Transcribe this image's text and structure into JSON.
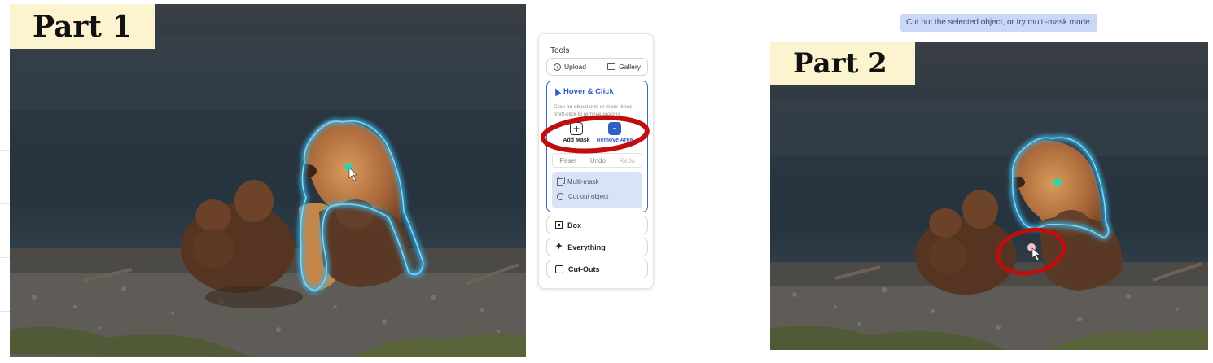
{
  "part1": {
    "label": "Part 1"
  },
  "part2": {
    "label": "Part 2"
  },
  "tooltip": "Cut out the selected object, or try multi-mask mode.",
  "tools_panel": {
    "title": "Tools",
    "upload_label": "Upload",
    "gallery_label": "Gallery",
    "hover_click": {
      "title": "Hover & Click",
      "description": "Click an object one or more times. Shift-click to remove regions.",
      "add_mask_label": "Add Mask",
      "remove_area_label": "Remove Area",
      "reset_label": "Reset",
      "undo_label": "Undo",
      "redo_label": "Redo",
      "multimask_label": "Multi-mask",
      "cutout_label": "Cut out object"
    },
    "box_label": "Box",
    "everything_label": "Everything",
    "cutouts_label": "Cut-Outs"
  },
  "colors": {
    "mask_outline": "#36b6ea",
    "annotation_red": "#c20d0d",
    "accent_blue": "#2e5fc1",
    "label_bg": "#fcf3cf"
  },
  "icons": [
    "upload-icon",
    "gallery-icon",
    "cursor-icon",
    "plus-icon",
    "minus-icon",
    "multimask-icon",
    "cutout-icon",
    "box-icon",
    "sparkle-icon",
    "cutouts-icon"
  ]
}
